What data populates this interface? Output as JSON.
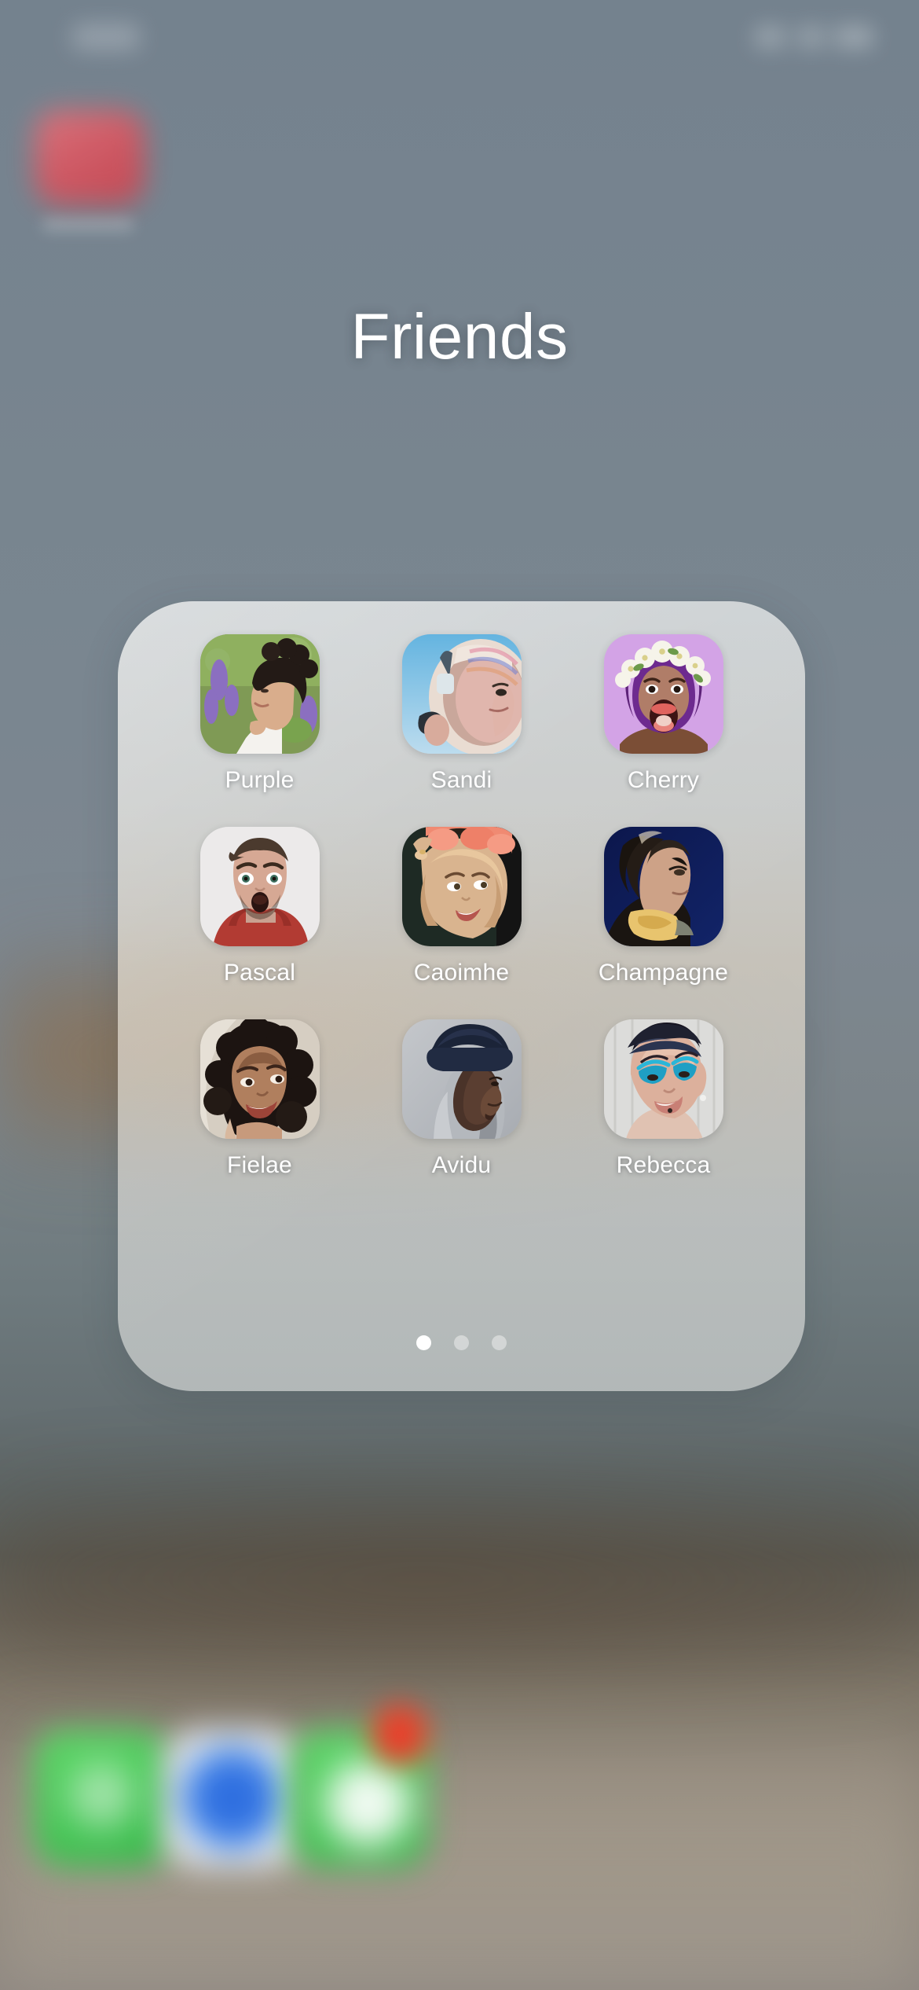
{
  "wallpaper": {
    "description": "blurred landscape photo, grey-blue sky over warm brown terrain",
    "sky_color": "#77848f",
    "ground_color": "#8d8478"
  },
  "status_bar": {
    "visible": true,
    "blurred": true,
    "time_placeholder": "",
    "indicators_placeholder": ""
  },
  "background_app": {
    "name": "",
    "icon_color": "#d4545f",
    "blurred": true
  },
  "folder": {
    "title": "Friends",
    "panel_color": "#e3e2dd",
    "panel_opacity": "0.74",
    "contacts": [
      {
        "name": "Purple",
        "icon": "photo-portrait-icon",
        "bg": "#7f9a55"
      },
      {
        "name": "Sandi",
        "icon": "photo-portrait-icon",
        "bg": "#8fc2e3"
      },
      {
        "name": "Cherry",
        "icon": "photo-portrait-icon",
        "bg": "#d6a8e8"
      },
      {
        "name": "Pascal",
        "icon": "photo-portrait-icon",
        "bg": "#e9e9ea"
      },
      {
        "name": "Caoimhe",
        "icon": "photo-portrait-icon",
        "bg": "#2a2f2a"
      },
      {
        "name": "Champagne",
        "icon": "photo-portrait-icon",
        "bg": "#101b4e"
      },
      {
        "name": "Fielae",
        "icon": "photo-portrait-icon",
        "bg": "#d9d2c6"
      },
      {
        "name": "Avidu",
        "icon": "photo-portrait-icon",
        "bg": "#b8bcc1"
      },
      {
        "name": "Rebecca",
        "icon": "photo-portrait-icon",
        "bg": "#dcdcda"
      }
    ],
    "pages": {
      "count": 3,
      "active_index": 0
    }
  },
  "dock": {
    "blurred": true,
    "items": [
      {
        "name": "phone-app",
        "color": "#36b94a",
        "badge": null
      },
      {
        "name": "safari-app",
        "color": "#2f6fe0",
        "badge": null
      },
      {
        "name": "messages-app",
        "color": "#36b94a",
        "badge": ""
      }
    ],
    "badge_color": "#e8402c"
  }
}
